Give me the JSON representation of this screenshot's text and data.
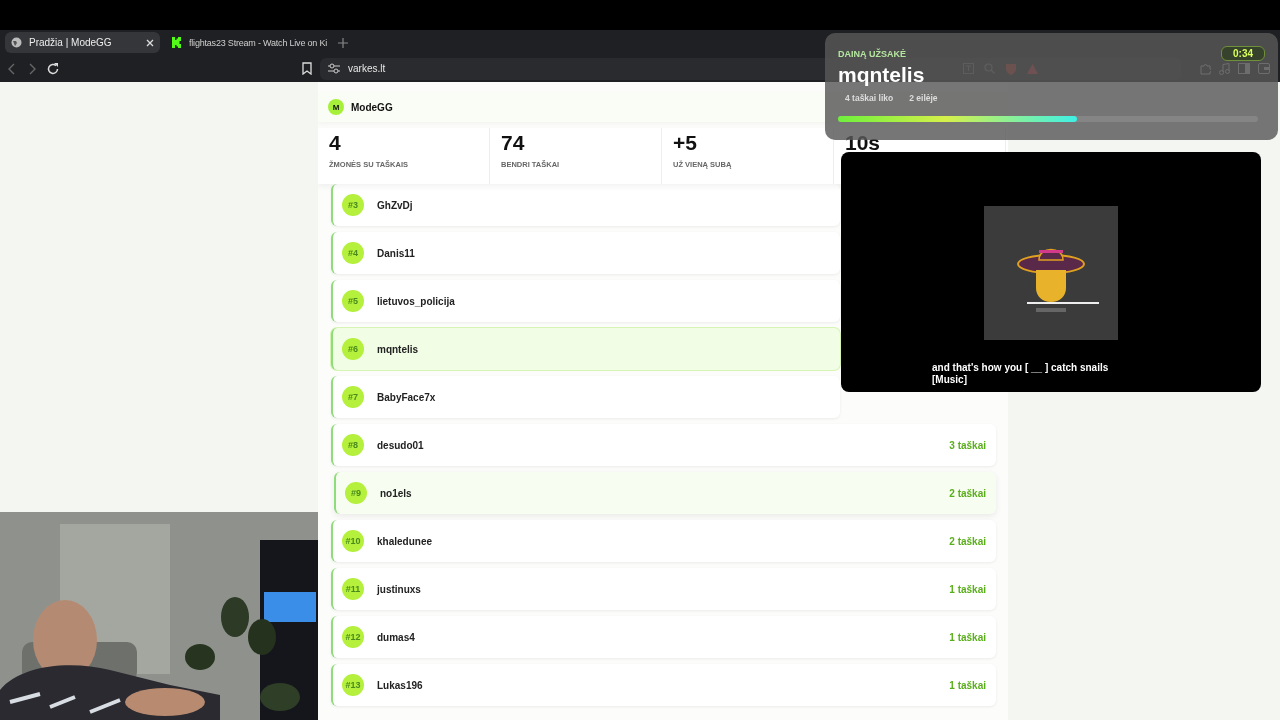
{
  "browser": {
    "tabs": [
      {
        "title": "Pradžia | ModeGG",
        "selected": true
      },
      {
        "title": "flightas23 Stream - Watch Live on Ki",
        "selected": false
      }
    ],
    "address": "varkes.lt"
  },
  "site": {
    "brand_initial": "M",
    "brand": "ModeGG"
  },
  "stats": [
    {
      "value": "4",
      "label": "ŽMONĖS SU TAŠKAIS"
    },
    {
      "value": "74",
      "label": "BENDRI TAŠKAI"
    },
    {
      "value": "+5",
      "label": "UŽ VIENĄ SUBĄ"
    },
    {
      "value": "10s"
    }
  ],
  "leaderboard": [
    {
      "rank": "#3",
      "name": "GhZvDj",
      "color": "#b4f03c",
      "highlighted": false,
      "hovered": false
    },
    {
      "rank": "#4",
      "name": "Danis11",
      "color": "#b4f03c",
      "highlighted": false,
      "hovered": false
    },
    {
      "rank": "#5",
      "name": "lietuvos_policija",
      "color": "#b4f03c",
      "highlighted": false,
      "hovered": false
    },
    {
      "rank": "#6",
      "name": "mqntelis",
      "color": "#b4f03c",
      "highlighted": true,
      "hovered": false
    },
    {
      "rank": "#7",
      "name": "BabyFace7x",
      "color": "#b4f03c",
      "highlighted": false,
      "hovered": false
    },
    {
      "rank": "#8",
      "name": "desudo01",
      "points": "3 taškai",
      "color": "#b4f03c",
      "highlighted": false,
      "hovered": false
    },
    {
      "rank": "#9",
      "name": "no1els",
      "points": "2 taškai",
      "color": "#b4f03c",
      "highlighted": false,
      "hovered": true
    },
    {
      "rank": "#10",
      "name": "khaledunee",
      "points": "2 taškai",
      "color": "#b4f03c",
      "highlighted": false,
      "hovered": false
    },
    {
      "rank": "#11",
      "name": "justinuxs",
      "points": "1 taškai",
      "color": "#b4f03c",
      "highlighted": false,
      "hovered": false
    },
    {
      "rank": "#12",
      "name": "dumas4",
      "points": "1 taškai",
      "color": "#b4f03c",
      "highlighted": false,
      "hovered": false
    },
    {
      "rank": "#13",
      "name": "Lukas196",
      "points": "1 taškai",
      "color": "#b4f03c",
      "highlighted": false,
      "hovered": false
    }
  ],
  "song_request": {
    "heading": "DAINĄ UŽSAKĖ",
    "user": "mqntelis",
    "points_left": "4 taškai liko",
    "queue": "2 eilėje",
    "level": 0.57,
    "timer": "0:34"
  },
  "video": {
    "captions": [
      "and that's how you [ __ ] catch snails",
      "[Music]"
    ]
  }
}
